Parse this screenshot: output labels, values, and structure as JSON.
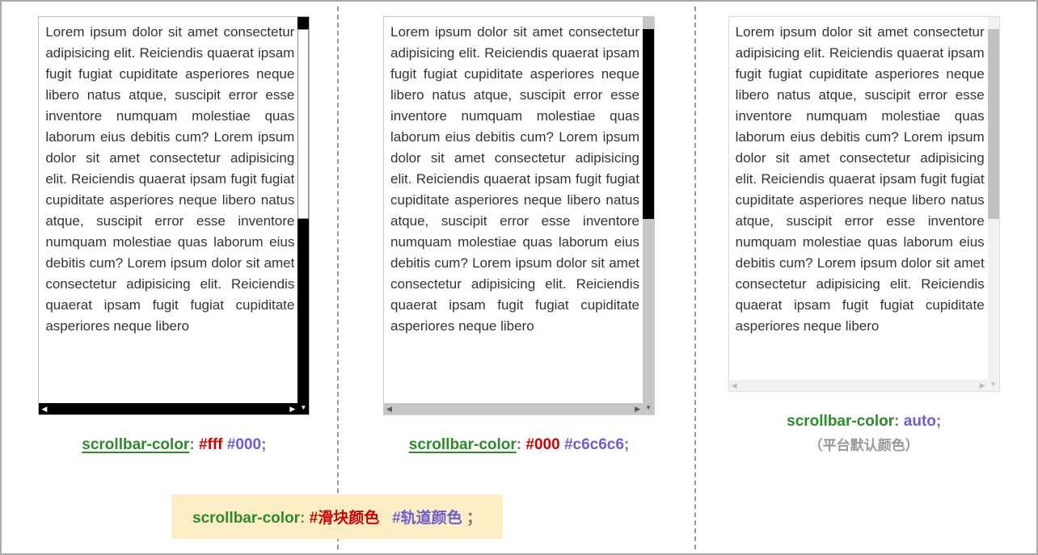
{
  "lorem": "Lorem ipsum dolor sit amet consectetur adipisicing elit. Reiciendis quaerat ipsam fugit fugiat cupiditate asperiores neque libero natus atque, suscipit error esse inventore numquam molestiae quas laborum eius debitis cum? Lorem ipsum dolor sit amet consectetur adipisicing elit. Reiciendis quaerat ipsam fugit fugiat cupiditate asperiores neque libero natus atque, suscipit error esse inventore numquam molestiae quas laborum eius debitis cum? Lorem ipsum dolor sit amet consectetur adipisicing elit. Reiciendis quaerat ipsam fugit fugiat cupiditate asperiores neque libero",
  "captionA": {
    "prop": "scrollbar-color",
    "colon": ": ",
    "v1": "#fff",
    "sp": " ",
    "v2": "#000",
    "semi": ";"
  },
  "captionB": {
    "prop": "scrollbar-color",
    "colon": ": ",
    "v1": "#000",
    "sp": " ",
    "v2": "#c6c6c6",
    "semi": ";"
  },
  "captionC": {
    "prop": "scrollbar-color",
    "colon": ": ",
    "v1": "auto",
    "semi": ";",
    "sub": "（平台默认颜色）"
  },
  "legend": {
    "prop": "scrollbar-color",
    "colon": ": ",
    "v1": "#滑块颜色",
    "gap": "   ",
    "v2": "#轨道颜色",
    "sp": " ",
    "semi": "；"
  }
}
